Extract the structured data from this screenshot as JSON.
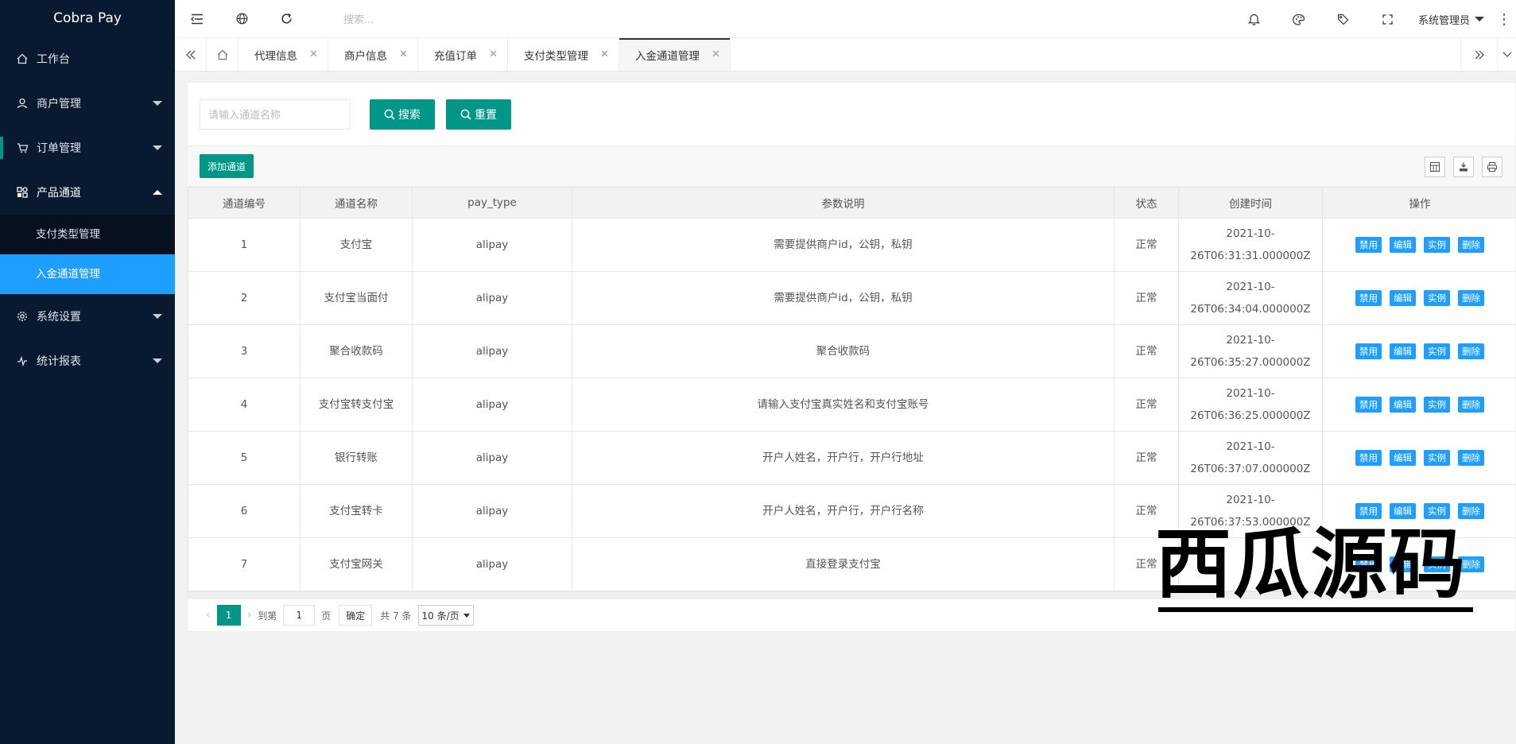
{
  "app": {
    "title": "Cobra Pay"
  },
  "sidebar": {
    "items": [
      {
        "label": "工作台",
        "icon": "home-icon"
      },
      {
        "label": "商户管理",
        "icon": "user-icon"
      },
      {
        "label": "订单管理",
        "icon": "cart-icon"
      },
      {
        "label": "产品通道",
        "icon": "apps-icon"
      },
      {
        "label": "系统设置",
        "icon": "gear-icon"
      },
      {
        "label": "统计报表",
        "icon": "chart-icon"
      }
    ],
    "submenu": [
      {
        "label": "支付类型管理"
      },
      {
        "label": "入金通道管理"
      }
    ]
  },
  "header": {
    "search_placeholder": "搜索...",
    "user": "系统管理员"
  },
  "tabs": [
    {
      "label": "代理信息"
    },
    {
      "label": "商户信息"
    },
    {
      "label": "充值订单"
    },
    {
      "label": "支付类型管理"
    },
    {
      "label": "入金通道管理"
    }
  ],
  "filter": {
    "placeholder": "请输入通道名称",
    "search_label": "搜索",
    "reset_label": "重置"
  },
  "toolbar": {
    "add_label": "添加通道"
  },
  "table": {
    "headers": [
      "通道编号",
      "通道名称",
      "pay_type",
      "参数说明",
      "状态",
      "创建时间",
      "操作"
    ],
    "ops": [
      "禁用",
      "编辑",
      "实例",
      "删除"
    ],
    "rows": [
      {
        "id": "1",
        "name": "支付宝",
        "pay_type": "alipay",
        "desc": "需要提供商户id，公钥，私钥",
        "status": "正常",
        "t1": "2021-10-",
        "t2": "26T06:31:31.000000Z"
      },
      {
        "id": "2",
        "name": "支付宝当面付",
        "pay_type": "alipay",
        "desc": "需要提供商户id，公钥，私钥",
        "status": "正常",
        "t1": "2021-10-",
        "t2": "26T06:34:04.000000Z"
      },
      {
        "id": "3",
        "name": "聚合收款码",
        "pay_type": "alipay",
        "desc": "聚合收款码",
        "status": "正常",
        "t1": "2021-10-",
        "t2": "26T06:35:27.000000Z"
      },
      {
        "id": "4",
        "name": "支付宝转支付宝",
        "pay_type": "alipay",
        "desc": "请输入支付宝真实姓名和支付宝账号",
        "status": "正常",
        "t1": "2021-10-",
        "t2": "26T06:36:25.000000Z"
      },
      {
        "id": "5",
        "name": "银行转账",
        "pay_type": "alipay",
        "desc": "开户人姓名，开户行，开户行地址",
        "status": "正常",
        "t1": "2021-10-",
        "t2": "26T06:37:07.000000Z"
      },
      {
        "id": "6",
        "name": "支付宝转卡",
        "pay_type": "alipay",
        "desc": "开户人姓名，开户行，开户行名称",
        "status": "正常",
        "t1": "2021-10-",
        "t2": "26T06:37:53.000000Z"
      },
      {
        "id": "7",
        "name": "支付宝网关",
        "pay_type": "alipay",
        "desc": "直接登录支付宝",
        "status": "正常",
        "t1": "",
        "t2": ""
      }
    ]
  },
  "pager": {
    "current": "1",
    "goto_label": "到第",
    "goto_value": "1",
    "page_label": "页",
    "confirm_label": "确定",
    "total_label": "共 7 条",
    "page_size": "10 条/页"
  },
  "watermark": "西瓜源码",
  "colors": {
    "sidebar_bg": "#091a30",
    "active_blue": "#1e9fff",
    "teal": "#009688"
  }
}
